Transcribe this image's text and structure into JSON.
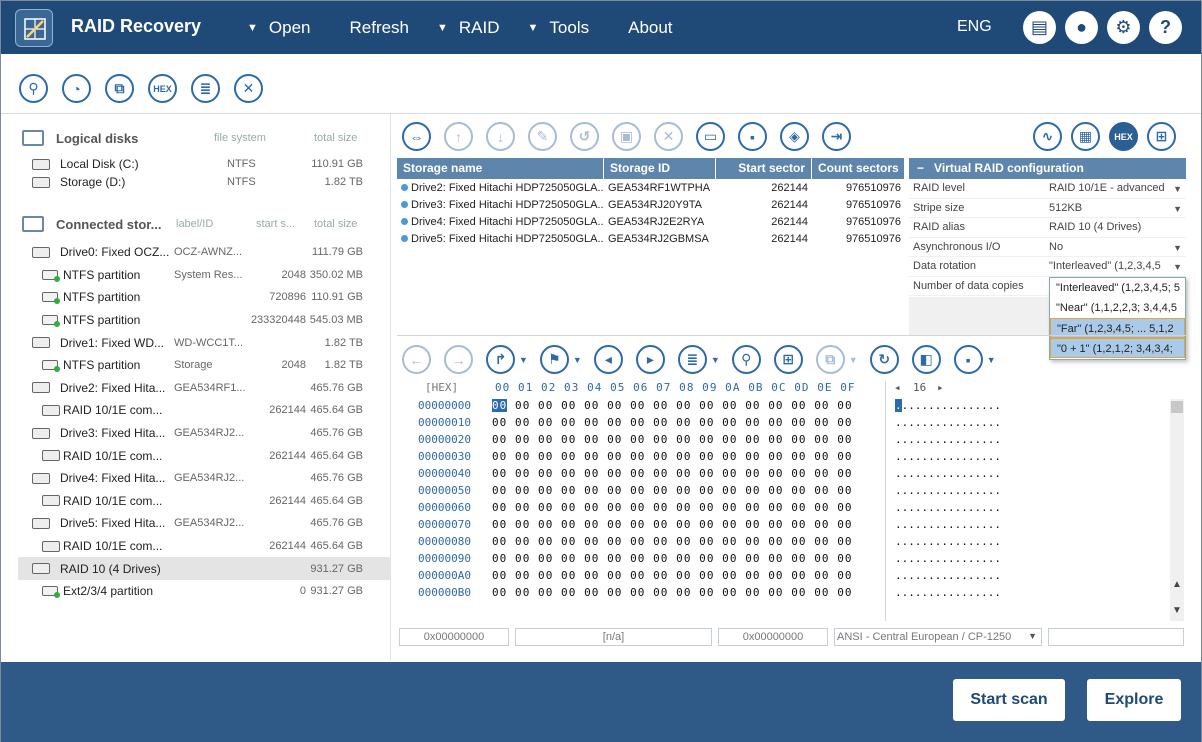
{
  "app": {
    "title": "RAID Recovery"
  },
  "menu": [
    {
      "label": "Open",
      "arrow": true
    },
    {
      "label": "Refresh",
      "arrow": false
    },
    {
      "label": "RAID",
      "arrow": true
    },
    {
      "label": "Tools",
      "arrow": true
    },
    {
      "label": "About",
      "arrow": false
    }
  ],
  "lang": "ENG",
  "left": {
    "logical": {
      "title": "Logical disks",
      "col1": "file system",
      "col2": "total size",
      "items": [
        {
          "name": "Local Disk (C:)",
          "fs": "NTFS",
          "size": "110.91 GB"
        },
        {
          "name": "Storage (D:)",
          "fs": "NTFS",
          "size": "1.82 TB"
        }
      ]
    },
    "connected": {
      "title": "Connected stor...",
      "col1": "label/ID",
      "col2": "start s...",
      "col3": "total size",
      "items": [
        {
          "type": "drive",
          "name": "Drive0: Fixed OCZ...",
          "label": "OCZ-AWNZ...",
          "start": "",
          "size": "111.79 GB"
        },
        {
          "type": "part",
          "name": "NTFS partition",
          "label": "System Res...",
          "start": "2048",
          "size": "350.02 MB"
        },
        {
          "type": "part",
          "name": "NTFS partition",
          "label": "",
          "start": "720896",
          "size": "110.91 GB"
        },
        {
          "type": "part",
          "name": "NTFS partition",
          "label": "",
          "start": "233320448",
          "size": "545.03 MB"
        },
        {
          "type": "drive",
          "name": "Drive1: Fixed WD...",
          "label": "WD-WCC1T...",
          "start": "",
          "size": "1.82 TB"
        },
        {
          "type": "part",
          "name": "NTFS partition",
          "label": "Storage",
          "start": "2048",
          "size": "1.82 TB"
        },
        {
          "type": "drive",
          "name": "Drive2: Fixed Hita...",
          "label": "GEA534RF1...",
          "start": "",
          "size": "465.76 GB"
        },
        {
          "type": "raid",
          "name": "RAID 10/1E com...",
          "label": "",
          "start": "262144",
          "size": "465.64 GB"
        },
        {
          "type": "drive",
          "name": "Drive3: Fixed Hita...",
          "label": "GEA534RJ2...",
          "start": "",
          "size": "465.76 GB"
        },
        {
          "type": "raid",
          "name": "RAID 10/1E com...",
          "label": "",
          "start": "262144",
          "size": "465.64 GB"
        },
        {
          "type": "drive",
          "name": "Drive4: Fixed Hita...",
          "label": "GEA534RJ2...",
          "start": "",
          "size": "465.76 GB"
        },
        {
          "type": "raid",
          "name": "RAID 10/1E com...",
          "label": "",
          "start": "262144",
          "size": "465.64 GB"
        },
        {
          "type": "drive",
          "name": "Drive5: Fixed Hita...",
          "label": "GEA534RJ2...",
          "start": "",
          "size": "465.76 GB"
        },
        {
          "type": "raid",
          "name": "RAID 10/1E com...",
          "label": "",
          "start": "262144",
          "size": "465.64 GB"
        },
        {
          "type": "array",
          "name": "RAID 10 (4 Drives)",
          "label": "",
          "start": "",
          "size": "931.27 GB",
          "selected": true
        },
        {
          "type": "part",
          "name": "Ext2/3/4 partition",
          "label": "",
          "start": "0",
          "size": "931.27 GB"
        }
      ]
    }
  },
  "storage_table": {
    "headers": [
      "Storage name",
      "Storage ID",
      "Start sector",
      "Count sectors"
    ],
    "rows": [
      [
        "Drive2: Fixed Hitachi HDP725050GLA...",
        "GEA534RF1WTPHA",
        "262144",
        "976510976"
      ],
      [
        "Drive3: Fixed Hitachi HDP725050GLA...",
        "GEA534RJ20Y9TA",
        "262144",
        "976510976"
      ],
      [
        "Drive4: Fixed Hitachi HDP725050GLA...",
        "GEA534RJ2E2RYA",
        "262144",
        "976510976"
      ],
      [
        "Drive5: Fixed Hitachi HDP725050GLA...",
        "GEA534RJ2GBMSA",
        "262144",
        "976510976"
      ]
    ]
  },
  "config": {
    "title": "Virtual RAID configuration",
    "collapse": "−",
    "rows": [
      {
        "k": "RAID level",
        "v": "RAID 10/1E - advanced",
        "dd": true
      },
      {
        "k": "Stripe size",
        "v": "512KB",
        "dd": true
      },
      {
        "k": "RAID alias",
        "v": "RAID 10 (4 Drives)",
        "dd": false
      },
      {
        "k": "Asynchronous I/O",
        "v": "No",
        "dd": true
      },
      {
        "k": "Data rotation",
        "v": "\"Interleaved\" (1,2,3,4,5",
        "dd": true
      },
      {
        "k": "Number of data copies",
        "v": "",
        "dd": false
      }
    ],
    "options": [
      "\"Interleaved\" (1,2,3,4,5; 5",
      "\"Near\" (1,1,2,2,3; 3,4,4,5",
      "\"Far\" (1,2,3,4,5; ... 5,1,2",
      "\"0 + 1\" (1,2,1,2; 3,4,3,4;"
    ]
  },
  "hex": {
    "label": "[HEX]",
    "cols": "00 01 02 03 04 05 06 07 08 09 0A 0B 0C 0D 0E 0F",
    "width": "16",
    "offsets": [
      "00000000",
      "00000010",
      "00000020",
      "00000030",
      "00000040",
      "00000050",
      "00000060",
      "00000070",
      "00000080",
      "00000090",
      "000000A0",
      "000000B0"
    ],
    "bytes": "00 00 00 00 00 00 00 00 00 00 00 00 00 00 00 00",
    "ascii": "................"
  },
  "status": {
    "offset": "0x00000000",
    "value": "[n/a]",
    "pos": "0x00000000",
    "encoding": "ANSI - Central European / CP-1250"
  },
  "footer": {
    "scan": "Start scan",
    "explore": "Explore"
  }
}
